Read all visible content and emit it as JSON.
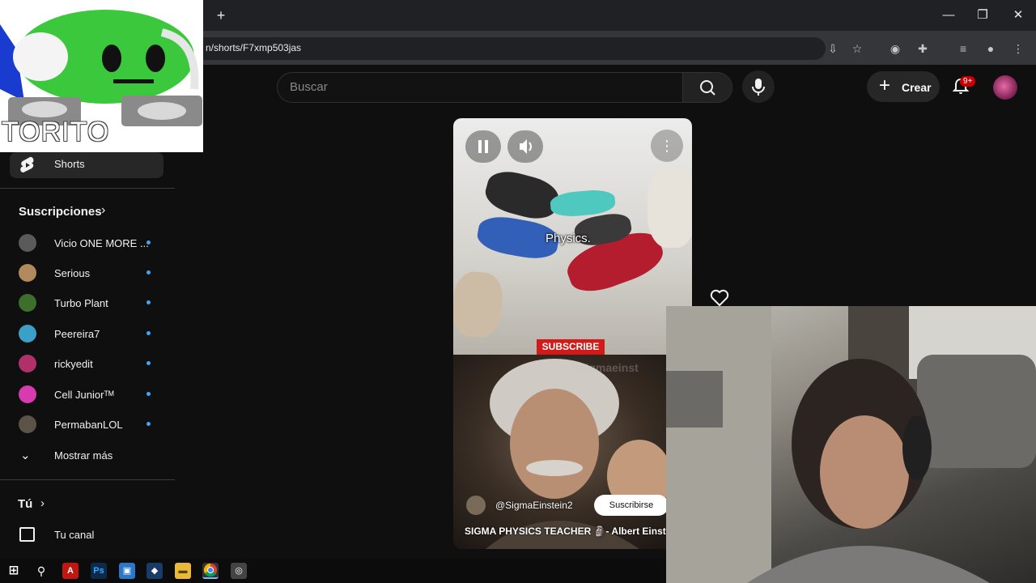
{
  "browser": {
    "url": "n/shorts/F7xmp503jas",
    "new_tab": "+",
    "win_minimize": "—",
    "win_restore": "❐",
    "win_close": "✕"
  },
  "header": {
    "search_placeholder": "Buscar",
    "create_label": "Crear",
    "notifications_badge": "9+"
  },
  "overlay": {
    "streamer_name": "TORITO"
  },
  "sidebar": {
    "shorts_label": "Shorts",
    "subscriptions_title": "Suscripciones",
    "subscriptions": [
      {
        "name": "Vicio ONE MORE ...",
        "color": "#5a5a5a"
      },
      {
        "name": "Serious",
        "color": "#b08a5c"
      },
      {
        "name": "Turbo Plant",
        "color": "#3c6e2c"
      },
      {
        "name": "Peereira7",
        "color": "#3aa0c8"
      },
      {
        "name": "rickyedit",
        "color": "#b0306c"
      },
      {
        "name": "Cell Juniorᵀᴹ",
        "color": "#d83ab0"
      },
      {
        "name": "PermabanLOL",
        "color": "#5d5248"
      }
    ],
    "show_more": "Mostrar más",
    "you_title": "Tú",
    "your_channel": "Tu canal"
  },
  "short": {
    "overlay_text": "Physics.",
    "sticker": "SUBSCRIBE",
    "watermark": "@sigmaeinst",
    "channel": "@SigmaEinstein2",
    "subscribe_label": "Suscribirse",
    "title": "SIGMA PHYSICS TEACHER 🗿- Albert Einste"
  },
  "taskbar": {
    "apps": [
      "start-icon",
      "search-icon",
      "acrobat-icon",
      "photoshop-icon",
      "app-icon",
      "app-icon",
      "folder-icon",
      "chrome-icon",
      "obs-icon"
    ]
  },
  "colors": {
    "accent": "#3ea6ff",
    "badge": "#cc0000",
    "subscribe_sticker": "#d11a1a"
  }
}
